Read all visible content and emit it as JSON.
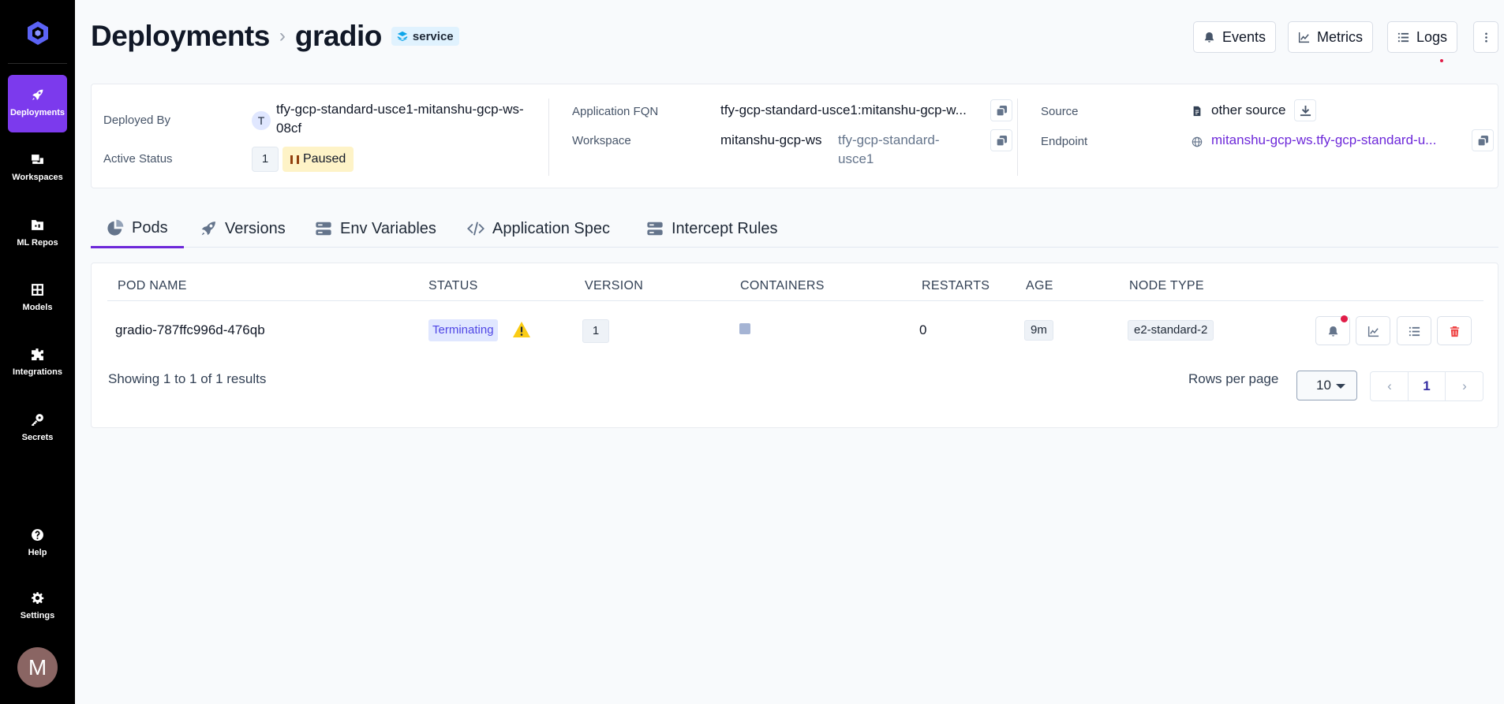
{
  "sidebar": {
    "logo": "truefoundry-logo",
    "items": [
      {
        "label": "Deployments",
        "icon": "rocket-icon",
        "active": true
      },
      {
        "label": "Workspaces",
        "icon": "workspaces-icon",
        "active": false
      },
      {
        "label": "ML Repos",
        "icon": "folder-icon",
        "active": false
      },
      {
        "label": "Models",
        "icon": "grid-icon",
        "active": false
      },
      {
        "label": "Integrations",
        "icon": "puzzle-icon",
        "active": false
      },
      {
        "label": "Secrets",
        "icon": "key-icon",
        "active": false
      },
      {
        "label": "Help",
        "icon": "help-icon",
        "active": false
      },
      {
        "label": "Settings",
        "icon": "gear-icon",
        "active": false
      }
    ],
    "avatar_initial": "M"
  },
  "header": {
    "breadcrumb_root": "Deployments",
    "breadcrumb_sep": "›",
    "title": "gradio",
    "type_badge": "service",
    "buttons": {
      "events": "Events",
      "metrics": "Metrics",
      "logs": "Logs"
    }
  },
  "info": {
    "deployed_by_label": "Deployed By",
    "deployed_by_initial": "T",
    "deployed_by_value": "tfy-gcp-standard-usce1-mitanshu-gcp-ws-08cf",
    "active_status_label": "Active Status",
    "active_status_count": "1",
    "active_status_state": "Paused",
    "fqn_label": "Application FQN",
    "fqn_value": "tfy-gcp-standard-usce1:mitanshu-gcp-w...",
    "workspace_label": "Workspace",
    "workspace_name": "mitanshu-gcp-ws",
    "workspace_cluster": "tfy-gcp-standard-usce1",
    "source_label": "Source",
    "source_value": "other source",
    "endpoint_label": "Endpoint",
    "endpoint_value": "mitanshu-gcp-ws.tfy-gcp-standard-u..."
  },
  "tabs": [
    {
      "label": "Pods",
      "icon": "pie-icon",
      "active": true
    },
    {
      "label": "Versions",
      "icon": "rocket-icon",
      "active": false
    },
    {
      "label": "Env Variables",
      "icon": "server-icon",
      "active": false
    },
    {
      "label": "Application Spec",
      "icon": "code-icon",
      "active": false
    },
    {
      "label": "Intercept Rules",
      "icon": "server-icon",
      "active": false
    }
  ],
  "table": {
    "columns": [
      "POD NAME",
      "STATUS",
      "VERSION",
      "CONTAINERS",
      "RESTARTS",
      "AGE",
      "NODE TYPE"
    ],
    "rows": [
      {
        "pod_name": "gradio-787ffc996d-476qb",
        "status": "Terminating",
        "version": "1",
        "restarts": "0",
        "age": "9m",
        "node_type": "e2-standard-2"
      }
    ],
    "footer": "Showing 1 to 1 of 1 results",
    "rows_per_page_label": "Rows per page",
    "rows_per_page_value": "10",
    "current_page": "1"
  },
  "colors": {
    "accent": "#7c3aed",
    "sidebar_bg": "#000000",
    "paused_bg": "#fef3c7",
    "terminating_text": "#4f46e5",
    "alert_red": "#e11d48"
  }
}
